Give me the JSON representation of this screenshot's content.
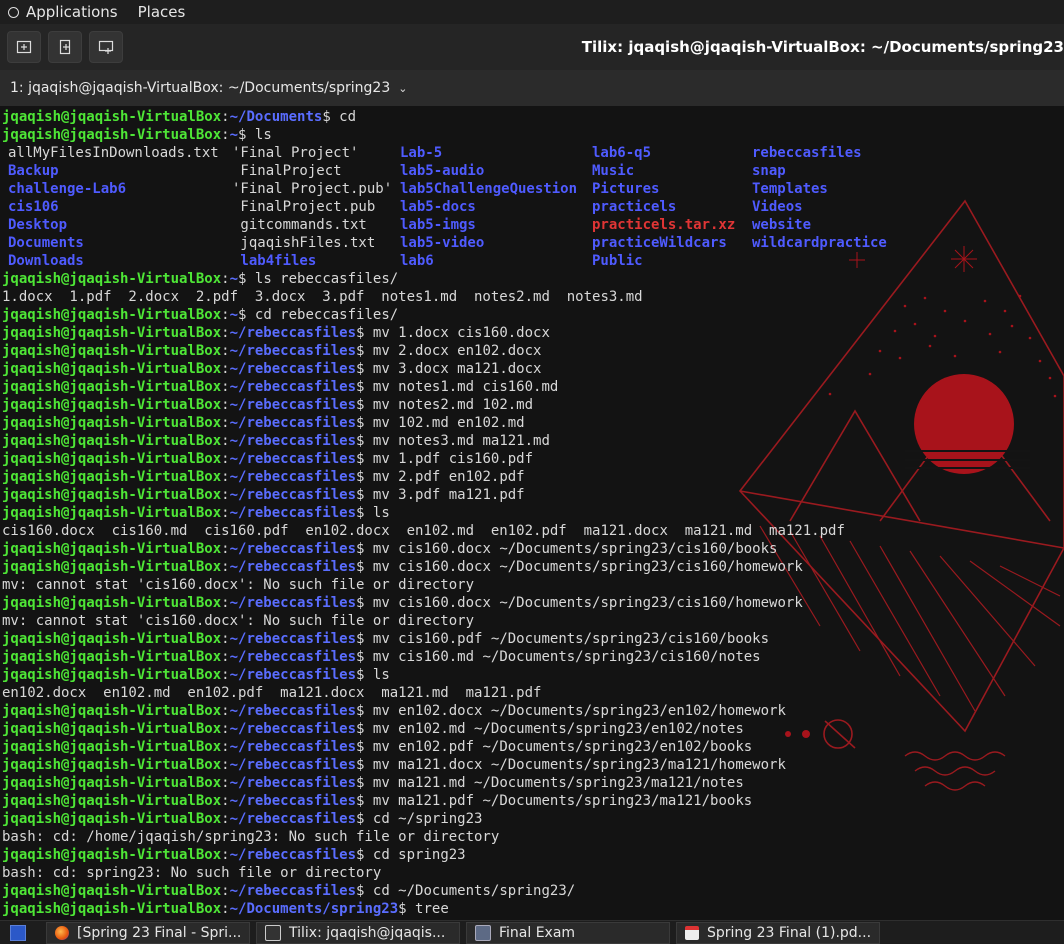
{
  "topbar": {
    "applications": "Applications",
    "places": "Places"
  },
  "titlebar": {
    "title": "Tilix: jqaqish@jqaqish-VirtualBox: ~/Documents/spring23"
  },
  "session": {
    "label": "1: jqaqish@jqaqish-VirtualBox: ~/Documents/spring23"
  },
  "terminal": {
    "ls_columns": [
      [
        {
          "t": "allMyFilesInDownloads.txt",
          "k": "f"
        },
        {
          "t": "Backup",
          "k": "d"
        },
        {
          "t": "challenge-Lab6",
          "k": "d"
        },
        {
          "t": "cis106",
          "k": "d"
        },
        {
          "t": "Desktop",
          "k": "d"
        },
        {
          "t": "Documents",
          "k": "d"
        },
        {
          "t": "Downloads",
          "k": "d"
        }
      ],
      [
        {
          "t": "'Final Project'",
          "k": "f"
        },
        {
          "t": " FinalProject",
          "k": "f"
        },
        {
          "t": "'Final Project.pub'",
          "k": "f"
        },
        {
          "t": " FinalProject.pub",
          "k": "f"
        },
        {
          "t": " gitcommands.txt",
          "k": "f"
        },
        {
          "t": " jqaqishFiles.txt",
          "k": "f"
        },
        {
          "t": " lab4files",
          "k": "d"
        }
      ],
      [
        {
          "t": "Lab-5",
          "k": "d"
        },
        {
          "t": "lab5-audio",
          "k": "d"
        },
        {
          "t": "lab5ChallengeQuestion",
          "k": "d"
        },
        {
          "t": "lab5-docs",
          "k": "d"
        },
        {
          "t": "lab5-imgs",
          "k": "d"
        },
        {
          "t": "lab5-video",
          "k": "d"
        },
        {
          "t": "lab6",
          "k": "d"
        }
      ],
      [
        {
          "t": "lab6-q5",
          "k": "d"
        },
        {
          "t": "Music",
          "k": "d"
        },
        {
          "t": "Pictures",
          "k": "d"
        },
        {
          "t": "practicels",
          "k": "d"
        },
        {
          "t": "practicels.tar.xz",
          "k": "a"
        },
        {
          "t": "practiceWildcars",
          "k": "d"
        },
        {
          "t": "Public",
          "k": "d"
        }
      ],
      [
        {
          "t": "rebeccasfiles",
          "k": "d"
        },
        {
          "t": "snap",
          "k": "d"
        },
        {
          "t": "Templates",
          "k": "d"
        },
        {
          "t": "Videos",
          "k": "d"
        },
        {
          "t": "website",
          "k": "d"
        },
        {
          "t": "wildcardpractice",
          "k": "d"
        }
      ]
    ],
    "lines": [
      {
        "u": "jqaqish@jqaqish-VirtualBox",
        "p": "~/Documents",
        "c": "cd"
      },
      {
        "u": "jqaqish@jqaqish-VirtualBox",
        "p": "~",
        "c": "ls"
      },
      {
        "ls": true
      },
      {
        "u": "jqaqish@jqaqish-VirtualBox",
        "p": "~",
        "c": "ls rebeccasfiles/"
      },
      {
        "o": "1.docx  1.pdf  2.docx  2.pdf  3.docx  3.pdf  notes1.md  notes2.md  notes3.md"
      },
      {
        "u": "jqaqish@jqaqish-VirtualBox",
        "p": "~",
        "c": "cd rebeccasfiles/"
      },
      {
        "u": "jqaqish@jqaqish-VirtualBox",
        "p": "~/rebeccasfiles",
        "c": "mv 1.docx cis160.docx"
      },
      {
        "u": "jqaqish@jqaqish-VirtualBox",
        "p": "~/rebeccasfiles",
        "c": "mv 2.docx en102.docx"
      },
      {
        "u": "jqaqish@jqaqish-VirtualBox",
        "p": "~/rebeccasfiles",
        "c": "mv 3.docx ma121.docx"
      },
      {
        "u": "jqaqish@jqaqish-VirtualBox",
        "p": "~/rebeccasfiles",
        "c": "mv notes1.md cis160.md"
      },
      {
        "u": "jqaqish@jqaqish-VirtualBox",
        "p": "~/rebeccasfiles",
        "c": "mv notes2.md 102.md"
      },
      {
        "u": "jqaqish@jqaqish-VirtualBox",
        "p": "~/rebeccasfiles",
        "c": "mv 102.md en102.md"
      },
      {
        "u": "jqaqish@jqaqish-VirtualBox",
        "p": "~/rebeccasfiles",
        "c": "mv notes3.md ma121.md"
      },
      {
        "u": "jqaqish@jqaqish-VirtualBox",
        "p": "~/rebeccasfiles",
        "c": "mv 1.pdf cis160.pdf"
      },
      {
        "u": "jqaqish@jqaqish-VirtualBox",
        "p": "~/rebeccasfiles",
        "c": "mv 2.pdf en102.pdf"
      },
      {
        "u": "jqaqish@jqaqish-VirtualBox",
        "p": "~/rebeccasfiles",
        "c": "mv 3.pdf ma121.pdf"
      },
      {
        "u": "jqaqish@jqaqish-VirtualBox",
        "p": "~/rebeccasfiles",
        "c": "ls"
      },
      {
        "o": "cis160.docx  cis160.md  cis160.pdf  en102.docx  en102.md  en102.pdf  ma121.docx  ma121.md  ma121.pdf"
      },
      {
        "u": "jqaqish@jqaqish-VirtualBox",
        "p": "~/rebeccasfiles",
        "c": "mv cis160.docx ~/Documents/spring23/cis160/books"
      },
      {
        "u": "jqaqish@jqaqish-VirtualBox",
        "p": "~/rebeccasfiles",
        "c": "mv cis160.docx ~/Documents/spring23/cis160/homework"
      },
      {
        "o": "mv: cannot stat 'cis160.docx': No such file or directory"
      },
      {
        "u": "jqaqish@jqaqish-VirtualBox",
        "p": "~/rebeccasfiles",
        "c": "mv cis160.docx ~/Documents/spring23/cis160/homework"
      },
      {
        "o": "mv: cannot stat 'cis160.docx': No such file or directory"
      },
      {
        "u": "jqaqish@jqaqish-VirtualBox",
        "p": "~/rebeccasfiles",
        "c": "mv cis160.pdf ~/Documents/spring23/cis160/books"
      },
      {
        "u": "jqaqish@jqaqish-VirtualBox",
        "p": "~/rebeccasfiles",
        "c": "mv cis160.md ~/Documents/spring23/cis160/notes"
      },
      {
        "u": "jqaqish@jqaqish-VirtualBox",
        "p": "~/rebeccasfiles",
        "c": "ls"
      },
      {
        "o": "en102.docx  en102.md  en102.pdf  ma121.docx  ma121.md  ma121.pdf"
      },
      {
        "u": "jqaqish@jqaqish-VirtualBox",
        "p": "~/rebeccasfiles",
        "c": "mv en102.docx ~/Documents/spring23/en102/homework"
      },
      {
        "u": "jqaqish@jqaqish-VirtualBox",
        "p": "~/rebeccasfiles",
        "c": "mv en102.md ~/Documents/spring23/en102/notes"
      },
      {
        "u": "jqaqish@jqaqish-VirtualBox",
        "p": "~/rebeccasfiles",
        "c": "mv en102.pdf ~/Documents/spring23/en102/books"
      },
      {
        "u": "jqaqish@jqaqish-VirtualBox",
        "p": "~/rebeccasfiles",
        "c": "mv ma121.docx ~/Documents/spring23/ma121/homework"
      },
      {
        "u": "jqaqish@jqaqish-VirtualBox",
        "p": "~/rebeccasfiles",
        "c": "mv ma121.md ~/Documents/spring23/ma121/notes"
      },
      {
        "u": "jqaqish@jqaqish-VirtualBox",
        "p": "~/rebeccasfiles",
        "c": "mv ma121.pdf ~/Documents/spring23/ma121/books"
      },
      {
        "u": "jqaqish@jqaqish-VirtualBox",
        "p": "~/rebeccasfiles",
        "c": "cd ~/spring23"
      },
      {
        "o": "bash: cd: /home/jqaqish/spring23: No such file or directory"
      },
      {
        "u": "jqaqish@jqaqish-VirtualBox",
        "p": "~/rebeccasfiles",
        "c": "cd spring23"
      },
      {
        "o": "bash: cd: spring23: No such file or directory"
      },
      {
        "u": "jqaqish@jqaqish-VirtualBox",
        "p": "~/rebeccasfiles",
        "c": "cd ~/Documents/spring23/"
      },
      {
        "u": "jqaqish@jqaqish-VirtualBox",
        "p": "~/Documents/spring23",
        "c": "tree"
      }
    ]
  },
  "taskbar": {
    "items": [
      {
        "label": "[Spring 23 Final - Spri...",
        "icon": "firefox-icon"
      },
      {
        "label": "Tilix: jqaqish@jqaqis...",
        "icon": "terminal-icon"
      },
      {
        "label": "Final Exam",
        "icon": "folder-icon"
      },
      {
        "label": "Spring 23 Final (1).pd...",
        "icon": "pdf-icon"
      }
    ]
  },
  "colors": {
    "user": "#4ee636",
    "path": "#5a6dff",
    "dir": "#4f5bff",
    "archive": "#e03535",
    "accent": "#b3141c"
  }
}
